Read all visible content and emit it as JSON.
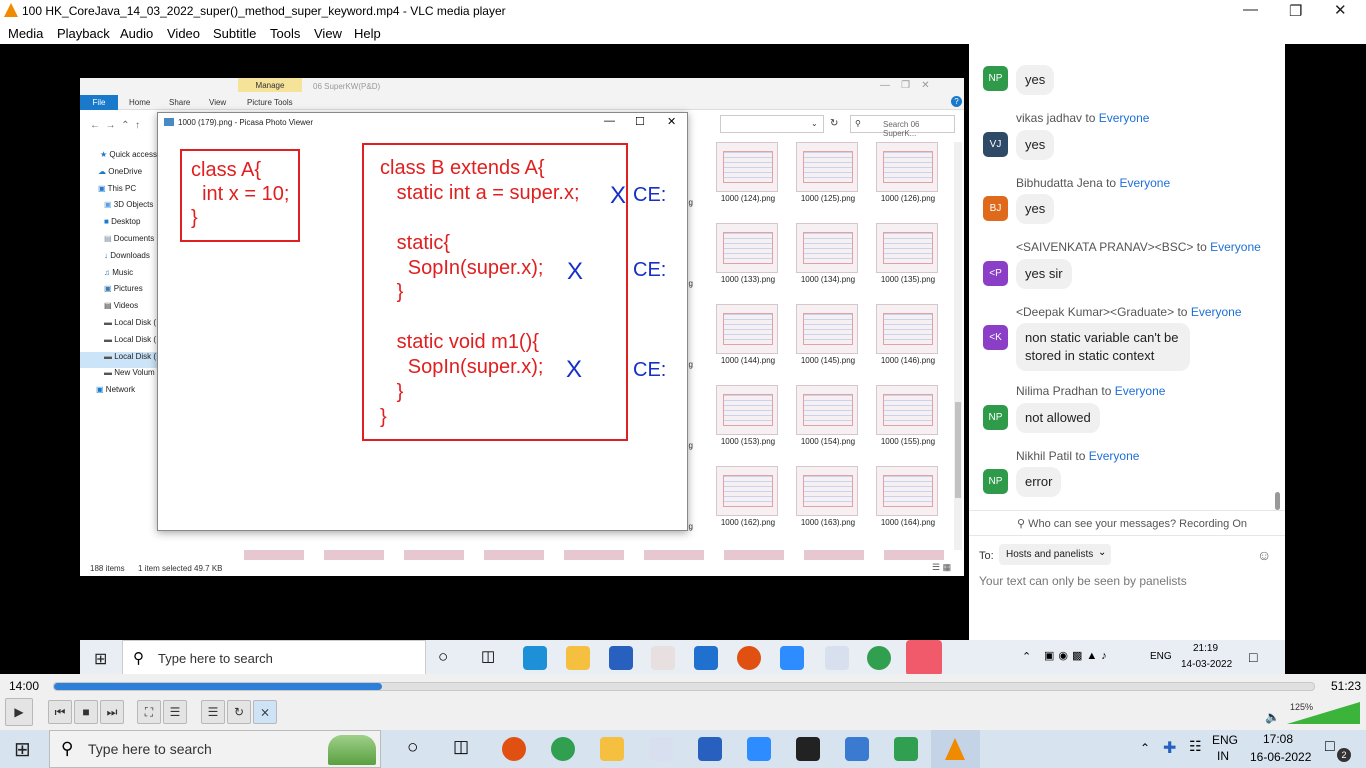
{
  "window": {
    "title": "100 HK_CoreJava_14_03_2022_super()_method_super_keyword.mp4 - VLC media player"
  },
  "menu": [
    "Media",
    "Playback",
    "Audio",
    "Video",
    "Subtitle",
    "Tools",
    "View",
    "Help"
  ],
  "explorer": {
    "manage": "Manage",
    "folder_title": "06 SuperKW(P&D)",
    "tabs": [
      "File",
      "Home",
      "Share",
      "View",
      "Picture Tools"
    ],
    "search_placeholder": "Search 06 SuperK...",
    "nav": [
      "Quick access",
      "OneDrive",
      "This PC",
      "3D Objects",
      "Desktop",
      "Documents",
      "Downloads",
      "Music",
      "Pictures",
      "Videos",
      "Local Disk (",
      "Local Disk (",
      "Local Disk (",
      "New Volum",
      "Network"
    ],
    "thumbs": [
      [
        "1000 (124).png",
        "1000 (125).png",
        "1000 (126).png"
      ],
      [
        "1000 (133).png",
        "1000 (134).png",
        "1000 (135).png"
      ],
      [
        "1000 (144).png",
        "1000 (145).png",
        "1000 (146).png"
      ],
      [
        "1000 (153).png",
        "1000 (154).png",
        "1000 (155).png"
      ],
      [
        "1000 (162).png",
        "1000 (163).png",
        "1000 (164).png"
      ]
    ],
    "cut_label": "ng",
    "status_items": "188 items",
    "status_selected": "1 item selected  49.7 KB"
  },
  "picasa": {
    "title": "1000 (179).png - Picasa Photo Viewer",
    "class_a": [
      "class A{",
      "  int x = 10;",
      "}"
    ],
    "class_b": [
      "class B extends A{",
      "   static int a = super.x;",
      "",
      "   static{",
      "     SopIn(super.x);",
      "   }",
      "",
      "   static void m1(){",
      "     SopIn(super.x);",
      "   }",
      "}"
    ],
    "mark": "X",
    "ce": "CE:"
  },
  "chat": {
    "messages": [
      {
        "initials": "NP",
        "color": "#2e9a4a",
        "sender": "",
        "to": "",
        "text": "yes"
      },
      {
        "initials": "VJ",
        "color": "#2e4a66",
        "sender": "vikas jadhav",
        "to": "Everyone",
        "text": "yes"
      },
      {
        "initials": "BJ",
        "color": "#e06a1c",
        "sender": "Bibhudatta Jena",
        "to": "Everyone",
        "text": "yes"
      },
      {
        "initials": "<P",
        "color": "#8a3fc6",
        "sender": "<SAIVENKATA PRANAV><BSC>",
        "to": "Everyone",
        "text": "yes sir"
      },
      {
        "initials": "<K",
        "color": "#8a3fc6",
        "sender": "<Deepak Kumar><Graduate>",
        "to": "Everyone",
        "text": "non static variable can't be stored in static context"
      },
      {
        "initials": "NP",
        "color": "#2e9a4a",
        "sender": "Nilima Pradhan",
        "to": "Everyone",
        "text": "not allowed"
      },
      {
        "initials": "NP",
        "color": "#2e9a4a",
        "sender": "Nikhil Patil",
        "to": "Everyone",
        "text": "error"
      }
    ],
    "to_word": "to",
    "visibility": "Who can see your messages? Recording On",
    "to_label": "To:",
    "recipient": "Hosts and panelists",
    "hint": "Your text can only be seen by panelists"
  },
  "inner_taskbar": {
    "search": "Type here to search",
    "lang": "ENG",
    "time": "21:19",
    "date": "14-03-2022"
  },
  "player": {
    "elapsed": "14:00",
    "total": "51:23",
    "progress": 0.26,
    "volume_label": "125%",
    "volume": 1.0
  },
  "taskbar": {
    "search": "Type here to search",
    "lang1": "ENG",
    "lang2": "IN",
    "time": "17:08",
    "date": "16-06-2022",
    "notifications": "2"
  }
}
